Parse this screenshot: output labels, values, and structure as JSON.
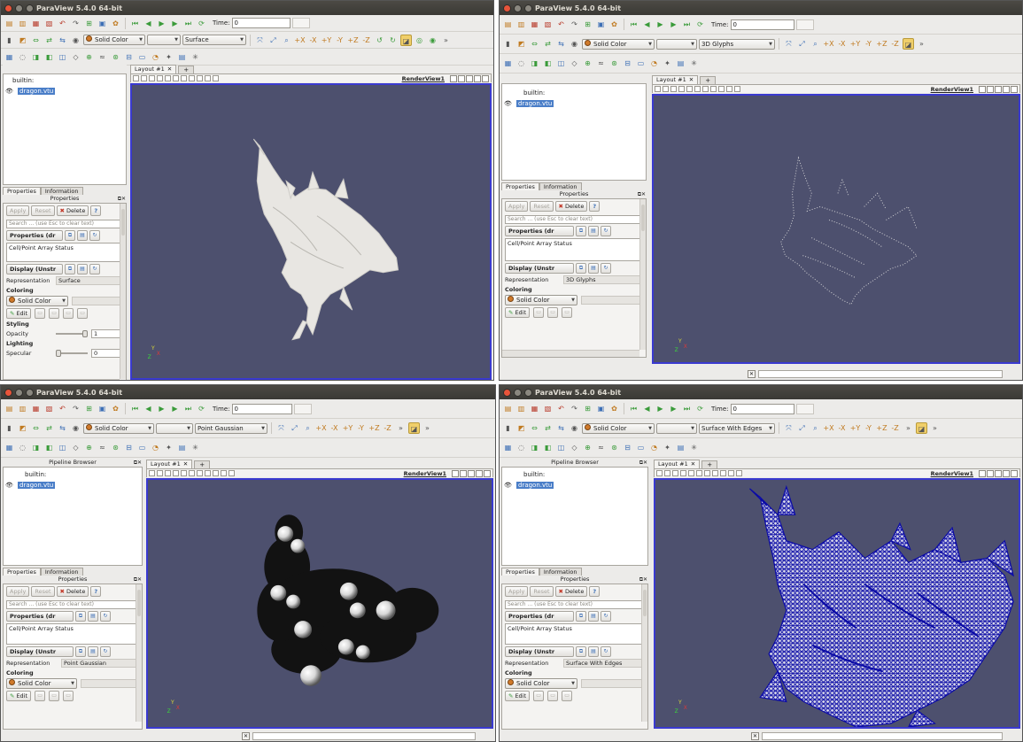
{
  "app_title": "ParaView 5.4.0 64-bit",
  "time_label": "Time:",
  "time_value": "0",
  "color_mode": "Solid Color",
  "pipeline": {
    "title": "Pipeline Browser",
    "root": "builtin:",
    "source": "dragon.vtu"
  },
  "tabs": {
    "properties": "Properties",
    "information": "Information"
  },
  "props_panel_title": "Properties",
  "buttons": {
    "apply": "Apply",
    "reset": "Reset",
    "delete": "Delete",
    "help": "?"
  },
  "search_placeholder": "Search ... (use Esc to clear text)",
  "sections": {
    "properties": "Properties (dr",
    "array_status": "Cell/Point Array Status",
    "display": "Display (Unstr",
    "representation_label": "Representation",
    "coloring": "Coloring",
    "edit": "Edit",
    "styling": "Styling",
    "opacity": "Opacity",
    "opacity_value": "1",
    "lighting": "Lighting",
    "specular": "Specular",
    "specular_value": "0"
  },
  "layout_tab": "Layout #1",
  "layout_add": "+",
  "render_view": "RenderView1",
  "windows": [
    {
      "representation": "Surface"
    },
    {
      "representation": "3D Glyphs"
    },
    {
      "representation": "Point Gaussian"
    },
    {
      "representation": "Surface With Edges"
    }
  ],
  "colors": {
    "background": "#4d506e",
    "surface": "#e8e6e2",
    "glyphs": "#e0e0e0",
    "gaussian": "#121212",
    "edges": "#0a0aa6",
    "active_border": "#3a3ad0",
    "selection": "#4a7ec8"
  }
}
